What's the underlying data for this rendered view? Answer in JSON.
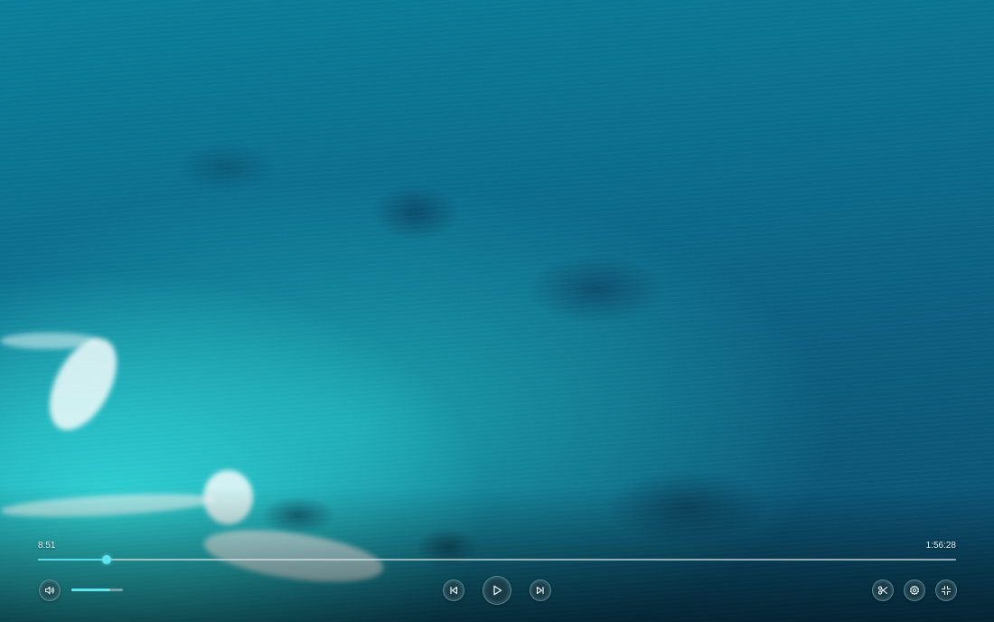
{
  "player": {
    "current_time": "8:51",
    "total_time": "1:56:28",
    "progress_fraction": 0.075,
    "volume_fraction": 0.75
  },
  "controls": {
    "left": [
      {
        "name": "volume-button",
        "icon": "speaker-icon"
      }
    ],
    "center": [
      {
        "name": "previous-button",
        "icon": "skip-back-icon"
      },
      {
        "name": "play-button",
        "icon": "play-icon"
      },
      {
        "name": "next-button",
        "icon": "skip-forward-icon"
      }
    ],
    "right": [
      {
        "name": "clip-button",
        "icon": "scissors-icon"
      },
      {
        "name": "settings-button",
        "icon": "gear-icon"
      },
      {
        "name": "exit-fullscreen-button",
        "icon": "collapse-icon"
      }
    ]
  },
  "colors": {
    "accent": "#5fe3ee",
    "track": "#dce6eb"
  }
}
